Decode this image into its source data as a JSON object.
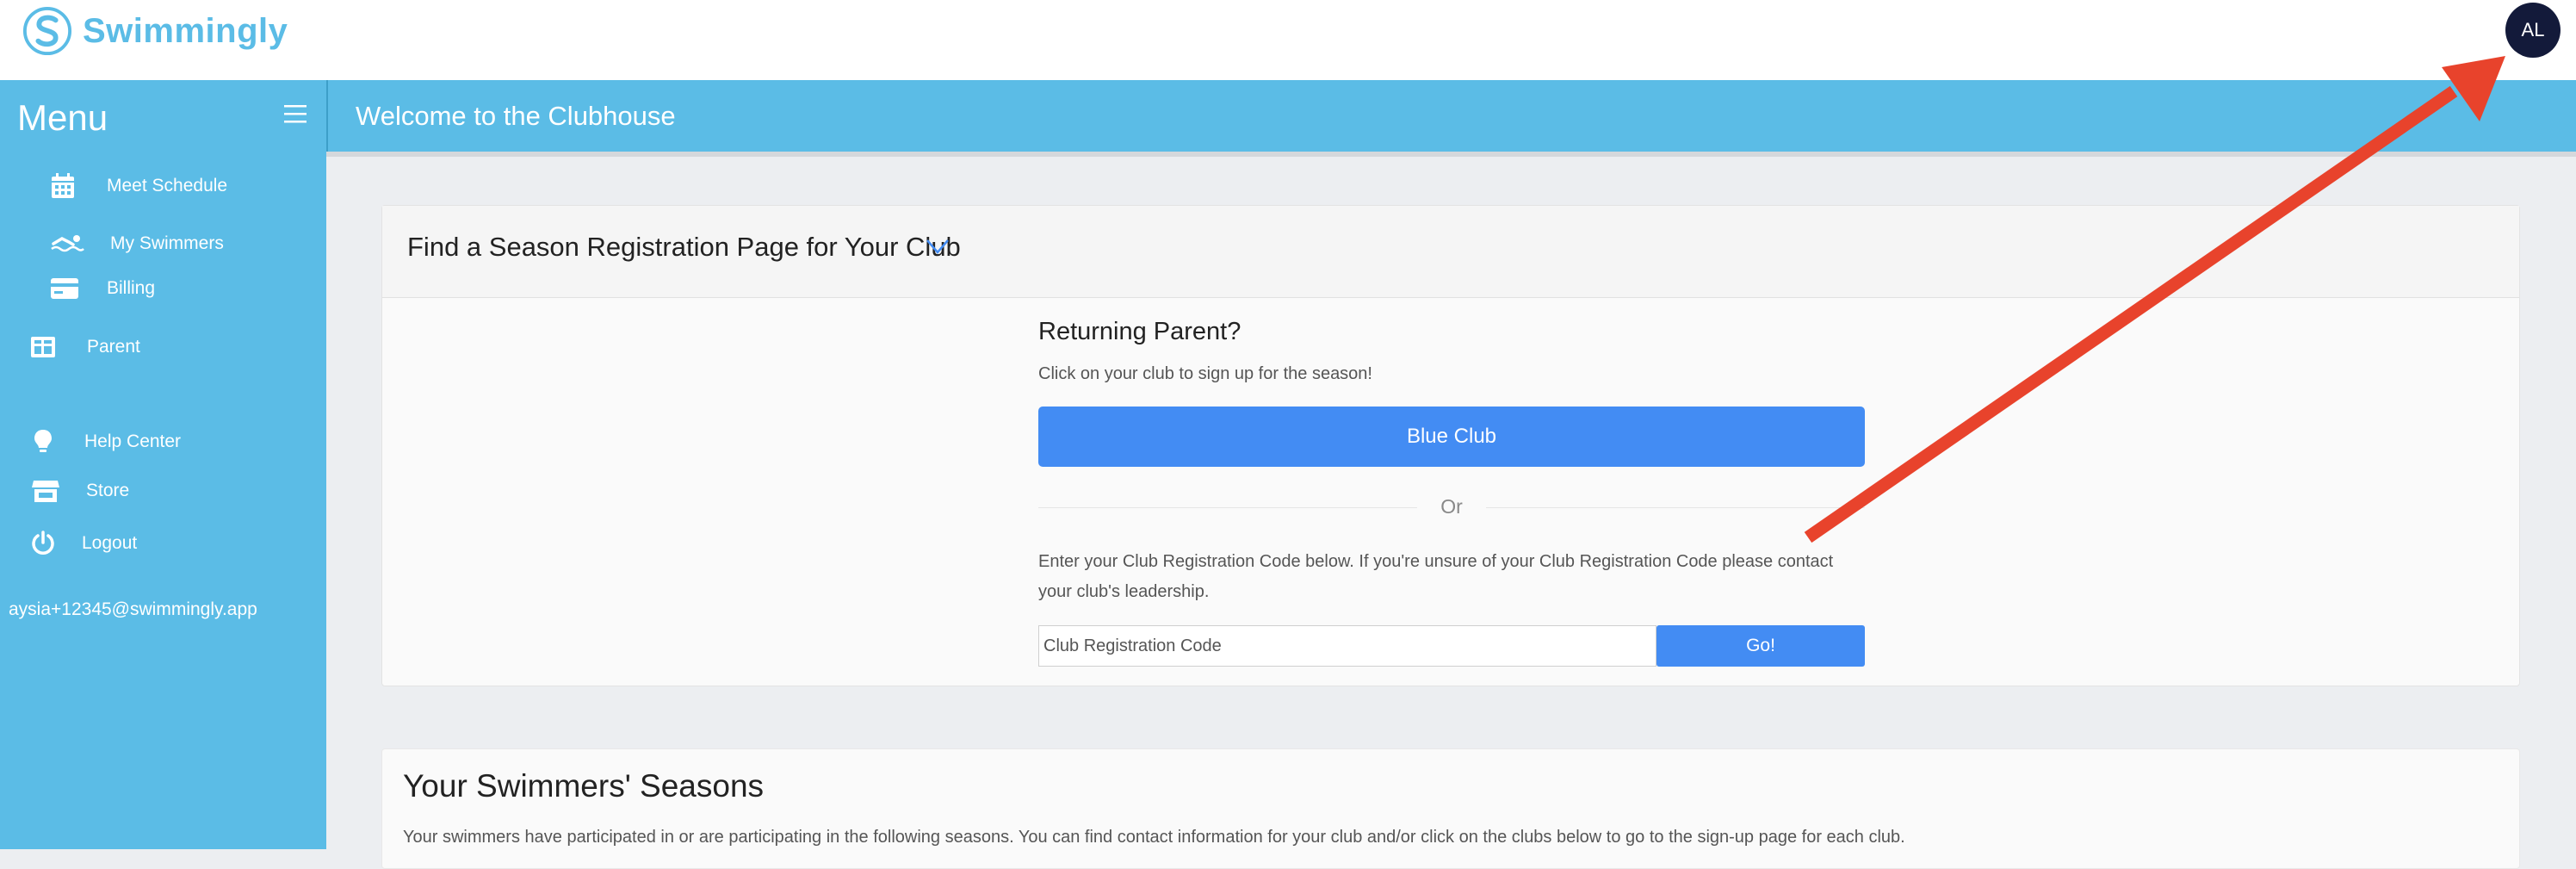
{
  "app": {
    "brand": "Swimmingly",
    "avatar_initials": "AL",
    "brand_color": "#5bbce6",
    "accent_color": "#438cf3"
  },
  "sidebar": {
    "title": "Menu",
    "items": [
      {
        "label": "Meet Schedule",
        "icon": "calendar-icon"
      },
      {
        "label": "My Swimmers",
        "icon": "swimmer-icon"
      },
      {
        "label": "Billing",
        "icon": "credit-card-icon"
      },
      {
        "label": "Parent",
        "icon": "grid-icon"
      },
      {
        "label": "Help Center",
        "icon": "lightbulb-icon"
      },
      {
        "label": "Store",
        "icon": "store-icon"
      },
      {
        "label": "Logout",
        "icon": "power-icon"
      }
    ],
    "email": "aysia+12345@swimmingly.app"
  },
  "header": {
    "title": "Welcome to the Clubhouse"
  },
  "registration_card": {
    "title": "Find a Season Registration Page for Your Club",
    "returning_heading": "Returning Parent?",
    "returning_instruction": "Click on your club to sign up for the season!",
    "club_button": "Blue Club",
    "or_label": "Or",
    "code_instruction": "Enter your Club Registration Code below. If you're unsure of your Club Registration Code please contact your club's leadership.",
    "code_placeholder": "Club Registration Code",
    "go_button": "Go!"
  },
  "seasons_card": {
    "title": "Your Swimmers' Seasons",
    "description": "Your swimmers have participated in or are participating in the following seasons. You can find contact information for your club and/or click on the clubs below to go to the sign-up page for each club."
  },
  "annotation": {
    "arrow_color": "#e8432c"
  }
}
